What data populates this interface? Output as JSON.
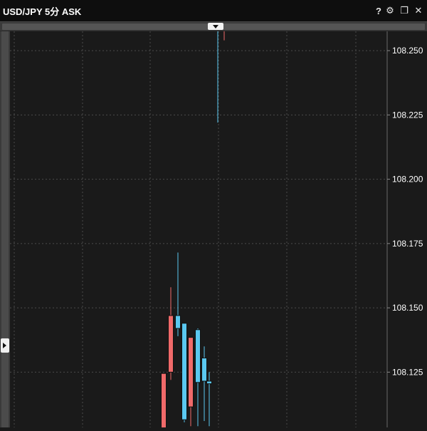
{
  "window": {
    "title": "USD/JPY 5分 ASK",
    "controls": [
      {
        "name": "help-icon",
        "glyph": "?"
      },
      {
        "name": "settings-gear-icon",
        "glyph": "⚙"
      },
      {
        "name": "restore-window-icon",
        "glyph": "❐"
      },
      {
        "name": "close-icon",
        "glyph": "✕"
      }
    ]
  },
  "colors": {
    "background": "#1a1a1a",
    "up_candle": "#5ac8f0",
    "down_candle": "#f06a6a",
    "grid": "#4a4a4a",
    "axis_text": "#ffffff"
  },
  "chart_data": {
    "type": "candlestick",
    "title": "USD/JPY 5分 ASK",
    "y_tick_labels": [
      "108.250",
      "108.225",
      "108.200",
      "108.175",
      "108.150",
      "108.125"
    ],
    "ylim": [
      108.1035,
      108.2575
    ],
    "grid": true,
    "candles": [
      {
        "open": 108.1245,
        "high": 108.1245,
        "low": 108.0995,
        "close": 108.0995,
        "color": "down"
      },
      {
        "open": 108.125,
        "high": 108.158,
        "low": 108.122,
        "close": 108.147,
        "color": "down"
      },
      {
        "open": 108.142,
        "high": 108.1715,
        "low": 108.139,
        "close": 108.147,
        "color": "up"
      },
      {
        "open": 108.144,
        "high": 108.144,
        "low": 108.1055,
        "close": 108.1065,
        "color": "up"
      },
      {
        "open": 108.1115,
        "high": 108.1385,
        "low": 108.104,
        "close": 108.1385,
        "color": "down"
      },
      {
        "open": 108.121,
        "high": 108.142,
        "low": 108.104,
        "close": 108.1415,
        "color": "up"
      },
      {
        "open": 108.1305,
        "high": 108.135,
        "low": 108.106,
        "close": 108.1215,
        "color": "up"
      },
      {
        "open": 108.1215,
        "high": 108.125,
        "low": 108.104,
        "close": 108.1205,
        "color": "up"
      },
      {
        "open": 108.258,
        "high": 108.258,
        "low": 108.222,
        "close": 108.258,
        "color": "up"
      },
      {
        "open": 108.258,
        "high": 108.258,
        "low": 108.254,
        "close": 108.258,
        "color": "down"
      }
    ]
  }
}
